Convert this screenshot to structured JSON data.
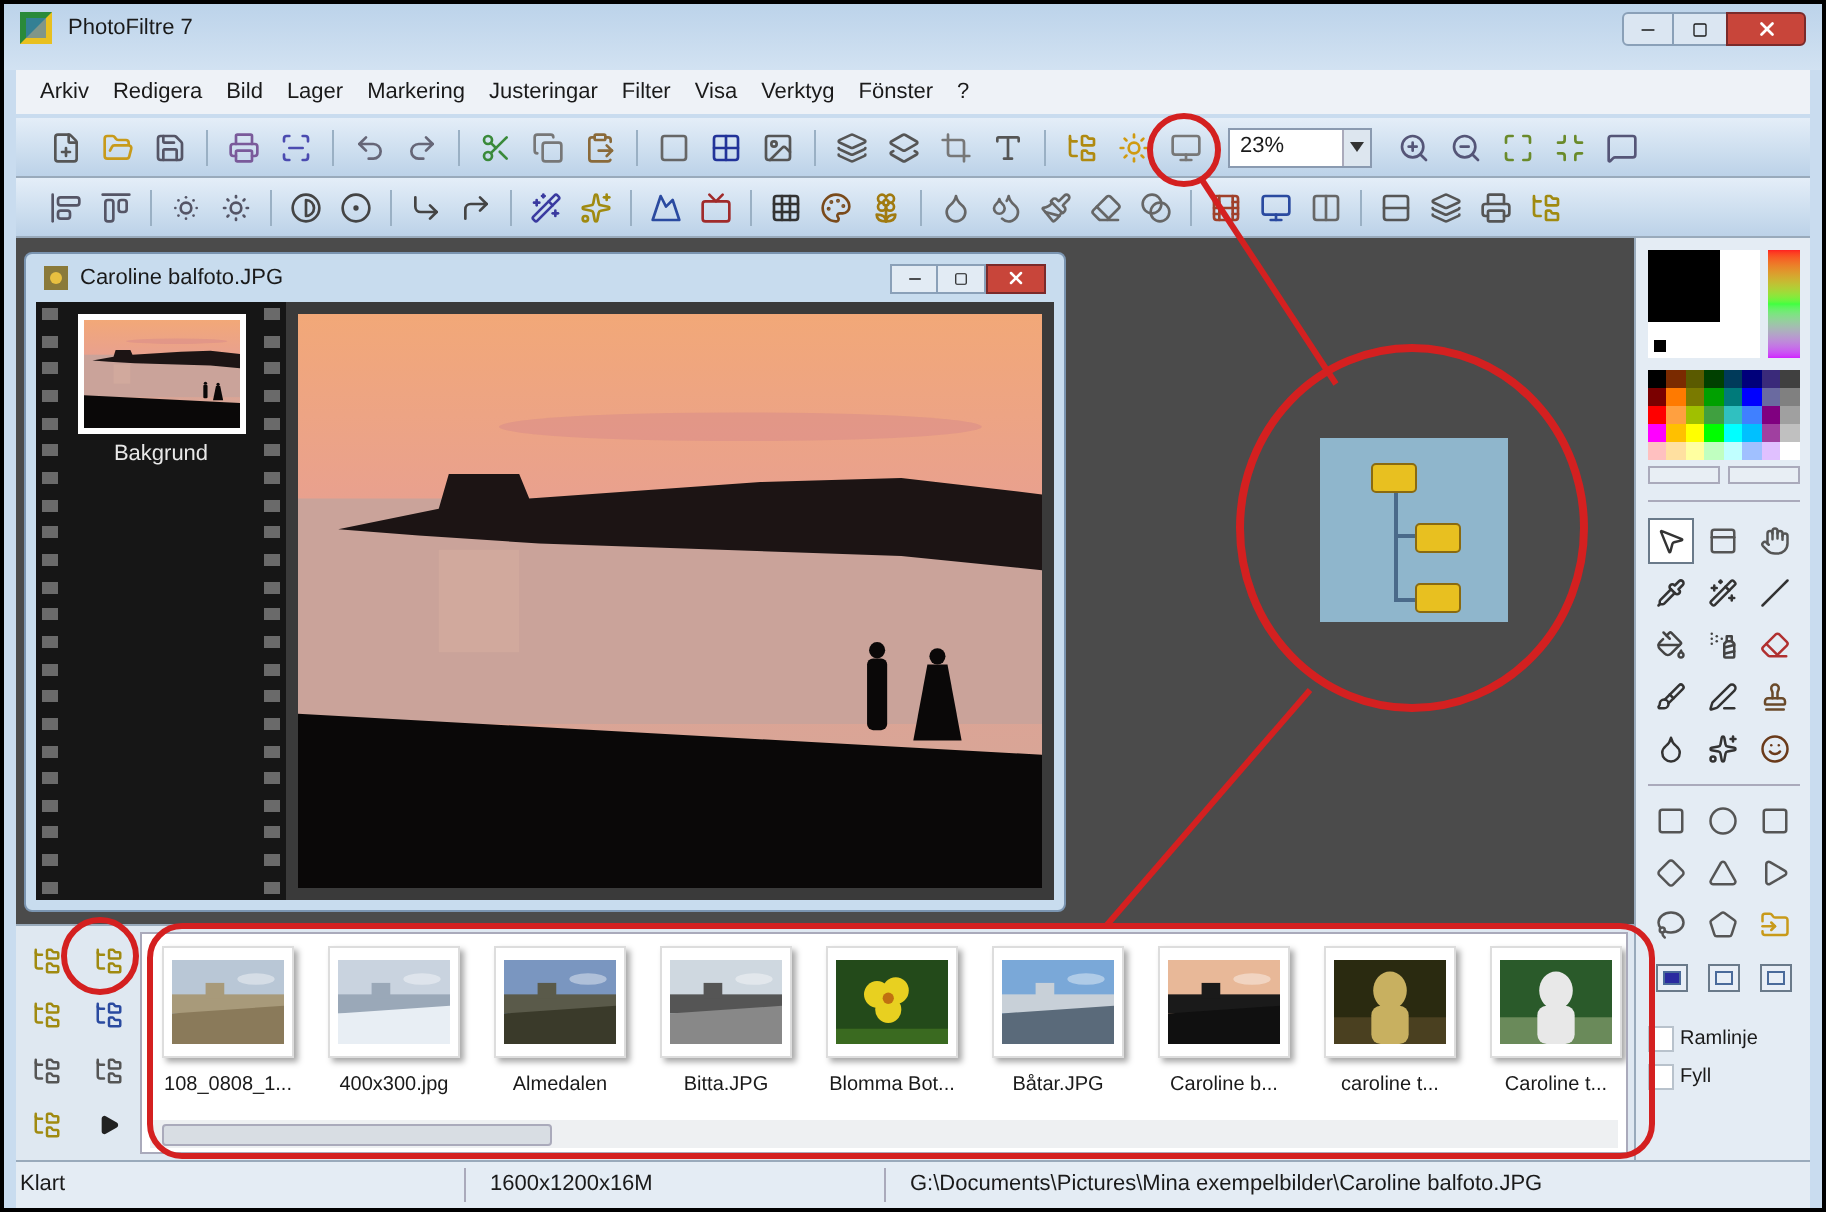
{
  "window": {
    "title": "PhotoFiltre 7"
  },
  "menu": [
    "Arkiv",
    "Redigera",
    "Bild",
    "Lager",
    "Markering",
    "Justeringar",
    "Filter",
    "Visa",
    "Verktyg",
    "Fönster",
    "?"
  ],
  "toolbar": {
    "zoom": "23%"
  },
  "document": {
    "title": "Caroline balfoto.JPG",
    "layers": [
      {
        "label": "Bakgrund",
        "selected": true
      }
    ]
  },
  "browser": {
    "thumbnails": [
      {
        "label": "108_0808_1..."
      },
      {
        "label": "400x300.jpg"
      },
      {
        "label": "Almedalen"
      },
      {
        "label": "Bitta.JPG"
      },
      {
        "label": "Blomma Bot..."
      },
      {
        "label": "Båtar.JPG"
      },
      {
        "label": "Caroline b..."
      },
      {
        "label": "caroline t..."
      },
      {
        "label": "Caroline t..."
      }
    ]
  },
  "tools": [
    {
      "selected": true
    },
    {
      "selected": false
    },
    {
      "selected": false
    },
    {
      "selected": false
    },
    {
      "selected": false
    },
    {
      "selected": false
    },
    {
      "selected": false
    },
    {
      "selected": false
    },
    {
      "selected": false
    },
    {
      "selected": false
    },
    {
      "selected": false
    },
    {
      "selected": false
    },
    {
      "selected": false
    },
    {
      "selected": false
    },
    {
      "selected": false
    }
  ],
  "options": [
    {
      "label": "Ramlinje",
      "checked": false
    },
    {
      "label": "Fyll",
      "checked": false
    }
  ],
  "status_bar": [
    "Klart",
    "1600x1200x16M",
    "G:\\Documents\\Pictures\\Mina exempelbilder\\Caroline balfoto.JPG"
  ]
}
